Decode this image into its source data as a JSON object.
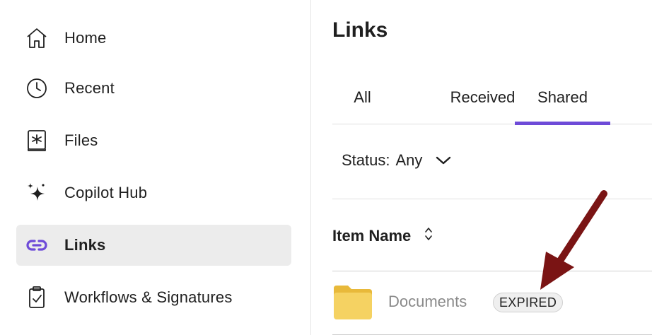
{
  "sidebar": {
    "items": [
      {
        "label": "Home",
        "icon": "home-icon",
        "active": false
      },
      {
        "label": "Recent",
        "icon": "clock-icon",
        "active": false
      },
      {
        "label": "Files",
        "icon": "files-icon",
        "active": false
      },
      {
        "label": "Copilot Hub",
        "icon": "sparkle-icon",
        "active": false
      },
      {
        "label": "Links",
        "icon": "link-icon",
        "active": true
      },
      {
        "label": "Workflows & Signatures",
        "icon": "clipboard-check-icon",
        "active": false
      }
    ]
  },
  "main": {
    "title": "Links",
    "tabs": [
      {
        "label": "All",
        "active": false
      },
      {
        "label": "Received",
        "active": false
      },
      {
        "label": "Shared",
        "active": true
      }
    ],
    "filter": {
      "label": "Status:",
      "value": "Any"
    },
    "table": {
      "column_header": "Item Name",
      "rows": [
        {
          "name": "Documents",
          "badge": "EXPIRED",
          "icon": "folder-icon"
        }
      ]
    }
  },
  "colors": {
    "accent": "#6e4bd8",
    "active_bg": "#ececec",
    "folder": "#f5d262",
    "annotation_arrow": "#7a1414"
  }
}
